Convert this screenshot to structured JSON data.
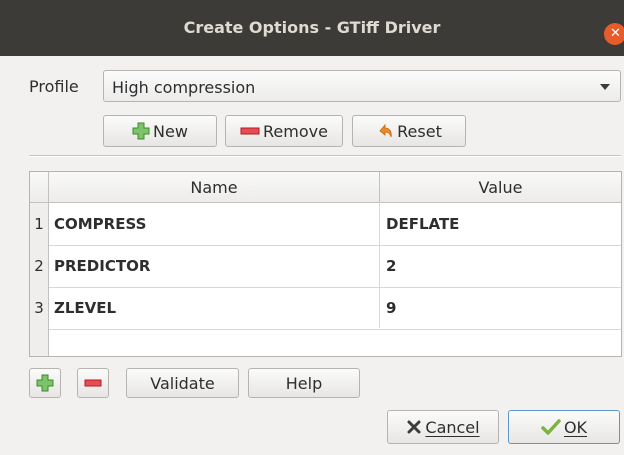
{
  "window": {
    "title": "Create Options - GTiff Driver"
  },
  "profile": {
    "label": "Profile",
    "selected": "High compression"
  },
  "profile_buttons": {
    "new": "New",
    "remove": "Remove",
    "reset": "Reset"
  },
  "table": {
    "headers": [
      "Name",
      "Value"
    ],
    "rows": [
      {
        "num": "1",
        "name": "COMPRESS",
        "value": "DEFLATE"
      },
      {
        "num": "2",
        "name": "PREDICTOR",
        "value": "2"
      },
      {
        "num": "3",
        "name": "ZLEVEL",
        "value": "9"
      }
    ]
  },
  "actions": {
    "validate": "Validate",
    "help": "Help"
  },
  "dialog_buttons": {
    "cancel": "Cancel",
    "ok": "OK"
  },
  "icons": {
    "close": "close-icon",
    "add": "plus-icon",
    "remove": "minus-icon",
    "reset": "reset-icon",
    "cancel": "x-icon",
    "ok": "checkmark-icon"
  },
  "colors": {
    "accent": "#e65c2b",
    "titlebar": "#3c3b37",
    "ok_border": "#5f96c7",
    "add_green": "#4aa13b",
    "remove_red": "#d9252f"
  }
}
